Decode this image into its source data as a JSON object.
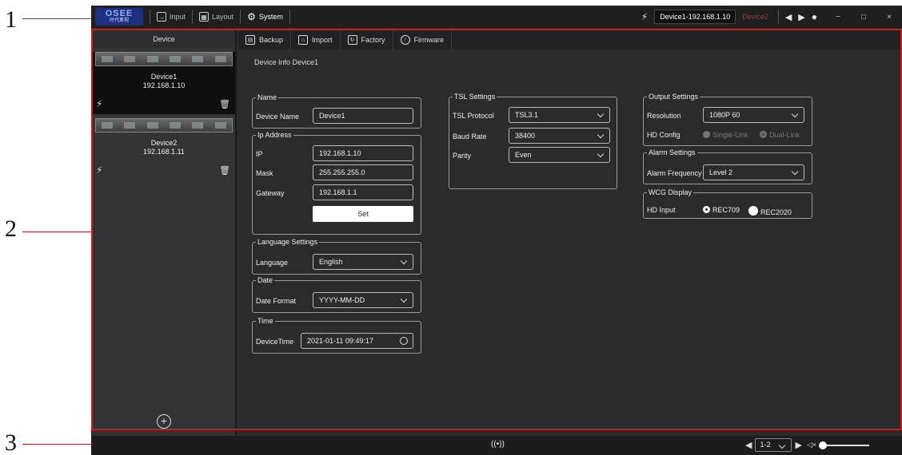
{
  "callouts": [
    "1",
    "2",
    "3"
  ],
  "topbar": {
    "logo_text": "OSEE",
    "logo_subtext": "时代奥视",
    "input_label": "Input",
    "layout_label": "Layout",
    "system_label": "System",
    "current_device": "Device1-192.168.1.10",
    "other_device": "Device2",
    "minimize": "−",
    "maximize": "□",
    "close": "×"
  },
  "sidebar": {
    "title": "Device",
    "devices": [
      {
        "name": "Device1",
        "ip": "192.168.1.10"
      },
      {
        "name": "Device2",
        "ip": "192.168.1.11"
      }
    ],
    "add_symbol": "+"
  },
  "toolbar": {
    "backup": "Backup",
    "import": "Import",
    "factory": "Factory",
    "firmware": "Firmware"
  },
  "breadcrumb": "Device Info  Device1",
  "name_group": {
    "legend": "Name",
    "label": "Device Name",
    "value": "Device1"
  },
  "ip_group": {
    "legend": "Ip Address",
    "ip_label": "IP",
    "ip_value": "192.168.1.10",
    "mask_label": "Mask",
    "mask_value": "255.255.255.0",
    "gateway_label": "Gateway",
    "gateway_value": "192.168.1.1",
    "set_button": "Set"
  },
  "language_group": {
    "legend": "Language Settings",
    "label": "Language",
    "value": "English"
  },
  "date_group": {
    "legend": "Date",
    "label": "Date Format",
    "value": "YYYY-MM-DD"
  },
  "time_group": {
    "legend": "Time",
    "label": "DeviceTime",
    "value": "2021-01-11 09:49:17"
  },
  "tsl_group": {
    "legend": "TSL Settings",
    "protocol_label": "TSL Protocol",
    "protocol_value": "TSL3.1",
    "baud_label": "Baud Rate",
    "baud_value": "38400",
    "parity_label": "Parity",
    "parity_value": "Even"
  },
  "output_group": {
    "legend": "Output Settings",
    "resolution_label": "Resolution",
    "resolution_value": "1080P 60",
    "hd_label": "HD Config",
    "single_link": "Single-Link",
    "dual_link": "Dual-Link"
  },
  "alarm_group": {
    "legend": "Alarm Settings",
    "label": "Alarm Frequency",
    "value": "Level 2"
  },
  "wcg_group": {
    "legend": "WCG Display",
    "label": "HD Input",
    "rec709": "REC709",
    "rec2020": "REC2020"
  },
  "statusbar": {
    "page_value": "1-2",
    "mute_symbol": "◁×"
  },
  "colors": {
    "accent_red": "#c41e1e",
    "panel": "#2b2b2b"
  }
}
